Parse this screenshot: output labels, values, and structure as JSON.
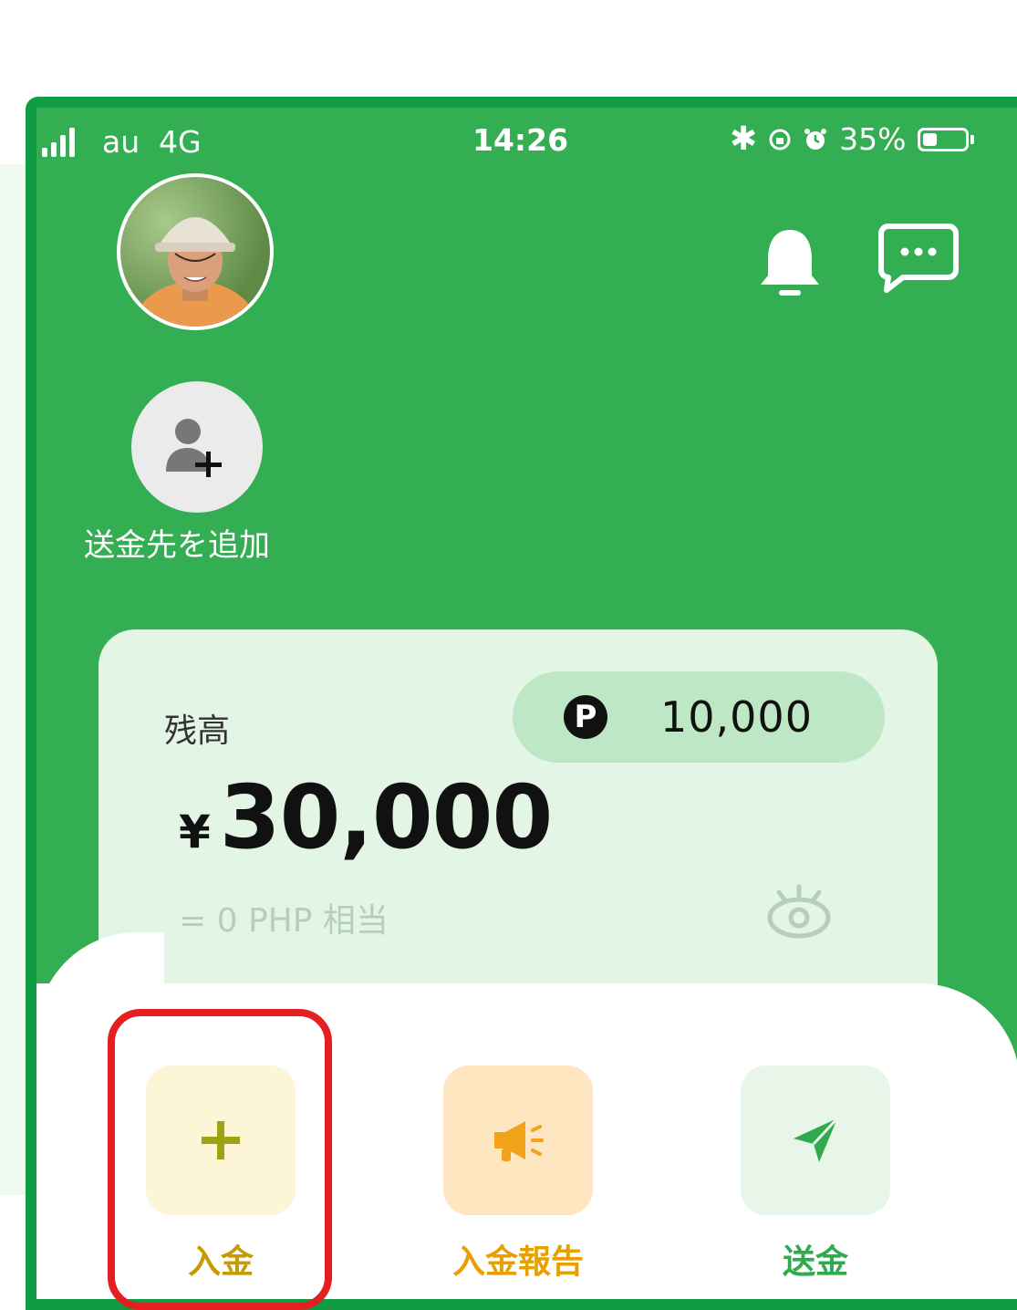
{
  "status_bar": {
    "carrier": "au",
    "network": "4G",
    "time": "14:26",
    "battery": "35%",
    "battery_level": 0.35
  },
  "add_recipient": {
    "label": "送金先を追加"
  },
  "balance_card": {
    "label": "残高",
    "points_badge": "P",
    "points": "10,000",
    "currency": "¥",
    "amount": "30,000",
    "php_equivalent": "= 0 PHP 相当"
  },
  "actions": [
    {
      "label": "入金",
      "icon": "plus-icon",
      "tile_color": "#fdf6d6",
      "label_color": "#c79a00"
    },
    {
      "label": "入金報告",
      "icon": "megaphone-icon",
      "tile_color": "#fde6c0",
      "label_color": "#e8a000"
    },
    {
      "label": "送金",
      "icon": "send-icon",
      "tile_color": "#e8f6ea",
      "label_color": "#2faa4c"
    }
  ],
  "colors": {
    "brand_green": "#34ae53",
    "highlight": "#e3201f"
  }
}
